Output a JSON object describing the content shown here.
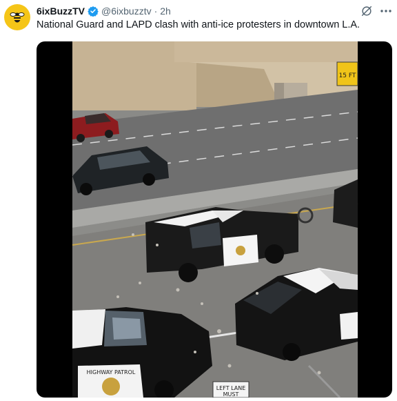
{
  "post": {
    "author_name": "6ixBuzzTV",
    "handle": "@6ixbuzztv",
    "separator": "·",
    "time": "2h",
    "text": "National Guard and LAPD clash with anti-ice protesters in downtown L.A.",
    "verified": true
  },
  "icons": {
    "avatar": "bee-logo",
    "verified": "verified-badge-icon",
    "grok": "grok-icon",
    "more": "more-icon"
  },
  "media": {
    "sign_clearance": "15 FT",
    "lane_sign_line1": "LEFT LANE",
    "lane_sign_line2": "MUST",
    "car_door_text": "HIGHWAY PATROL"
  },
  "colors": {
    "accent": "#1d9bf0",
    "avatar_bg": "#f5c518",
    "secondary_text": "#536471"
  }
}
